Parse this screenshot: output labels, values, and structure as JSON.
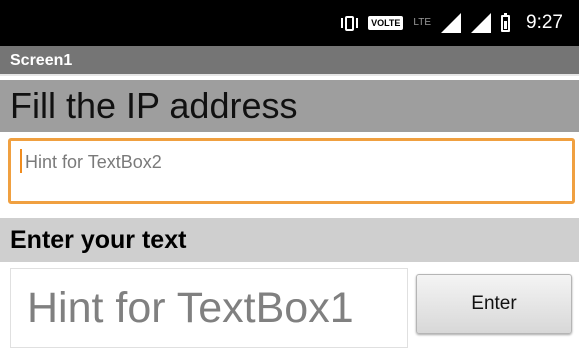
{
  "status_bar": {
    "time": "9:27",
    "volte_label": "VOLTE",
    "lte_label": "LTE",
    "icons": [
      "vibrate-icon",
      "volte-icon",
      "lte-icon",
      "signal-icon",
      "signal-icon",
      "battery-icon"
    ]
  },
  "title_bar": {
    "title": "Screen1"
  },
  "main": {
    "heading": "Fill the IP address",
    "ip_textbox": {
      "value": "",
      "placeholder": "Hint for TextBox2"
    },
    "text_label": "Enter your text",
    "text_input": {
      "value": "",
      "placeholder": "Hint for TextBox1"
    },
    "enter_button_label": "Enter"
  },
  "colors": {
    "status_bar_bg": "#000000",
    "title_bar_bg": "#757575",
    "heading_bg": "#9e9e9e",
    "label_bg": "#cfcfcf",
    "focus_border": "#f0a040"
  }
}
